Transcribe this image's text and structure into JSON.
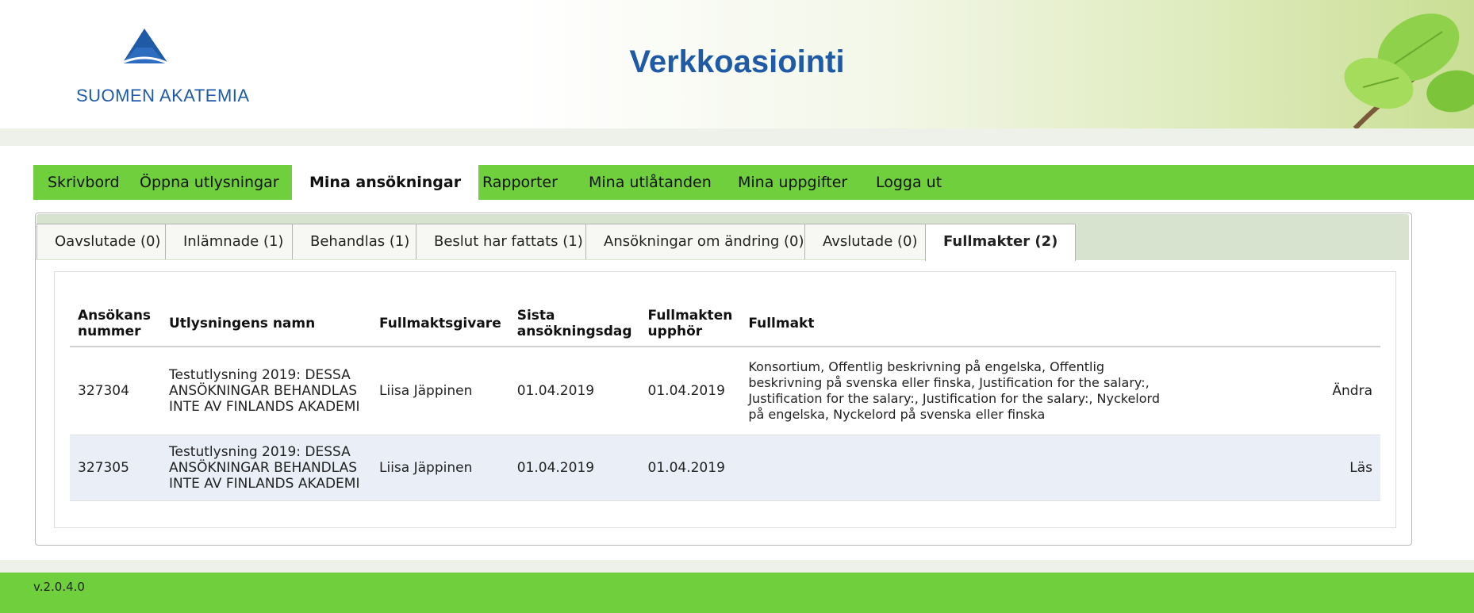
{
  "header": {
    "logo_text": "SUOMEN AKATEMIA",
    "app_title": "Verkkoasiointi"
  },
  "colors": {
    "brand_blue": "#1f5aa6",
    "nav_green": "#6fcf3d",
    "subtab_bg": "#d8e3cf",
    "link_blue": "#2b3fa0"
  },
  "mainnav": {
    "items": [
      {
        "label": "Skrivbord"
      },
      {
        "label": "Öppna utlysningar"
      },
      {
        "label": "Mina ansökningar",
        "active": true
      },
      {
        "label": "Rapporter"
      },
      {
        "label": "Mina utlåtanden"
      },
      {
        "label": "Mina uppgifter"
      },
      {
        "label": "Logga ut"
      }
    ]
  },
  "subtabs": {
    "items": [
      {
        "label": "Oavslutade (0)"
      },
      {
        "label": "Inlämnade (1)"
      },
      {
        "label": "Behandlas (1)"
      },
      {
        "label": "Beslut har fattats (1)"
      },
      {
        "label": "Ansökningar om ändring (0)"
      },
      {
        "label": "Avslutade (0)"
      },
      {
        "label": "Fullmakter (2)",
        "active": true
      }
    ]
  },
  "table": {
    "headers": {
      "number_line1": "Ansökans",
      "number_line2": "nummer",
      "call_name": "Utlysningens namn",
      "grantor": "Fullmaktsgivare",
      "deadline_line1": "Sista",
      "deadline_line2": "ansökningsdag",
      "expires_line1": "Fullmakten",
      "expires_line2": "upphör",
      "proxy": "Fullmakt"
    },
    "rows": [
      {
        "number": "327304",
        "call_name_line1": "Testutlysning 2019: DESSA",
        "call_name_line2": "ANSÖKNINGAR BEHANDLAS",
        "call_name_line3": "INTE AV FINLANDS AKADEMI",
        "grantor": "Liisa Jäppinen",
        "deadline": "01.04.2019",
        "expires": "01.04.2019",
        "proxy_line1": "Konsortium, Offentlig beskrivning på engelska, Offentlig",
        "proxy_line2": "beskrivning på svenska eller finska, Justification for the salary:,",
        "proxy_line3": "Justification for the salary:, Justification for the salary:, Nyckelord",
        "proxy_line4": "på engelska, Nyckelord på svenska eller finska",
        "action": "Ändra"
      },
      {
        "number": "327305",
        "call_name_line1": "Testutlysning 2019: DESSA",
        "call_name_line2": "ANSÖKNINGAR BEHANDLAS",
        "call_name_line3": "INTE AV FINLANDS AKADEMI",
        "grantor": "Liisa Jäppinen",
        "deadline": "01.04.2019",
        "expires": "01.04.2019",
        "action": "Läs"
      }
    ]
  },
  "footer": {
    "version": "v.2.0.4.0"
  }
}
